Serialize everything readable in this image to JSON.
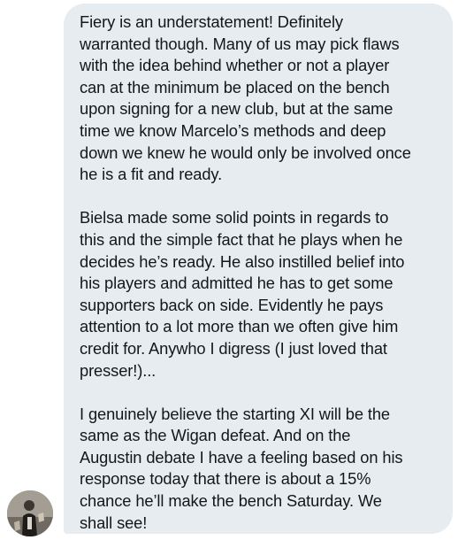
{
  "conversation": {
    "message": {
      "paragraphs": [
        "Fiery is an understatement! Definitely\nwarranted though. Many of us may pick flaws\nwith the idea behind whether or not a player\ncan at the minimum be placed on the bench\nupon signing for a new club, but at the same\ntime we know Marcelo’s methods and deep\ndown we knew he would only be involved once\nhe is a fit and ready.",
        "Bielsa made some solid points in regards to\nthis and the simple fact that he plays when he\ndecides he’s ready. He also instilled belief into\nhis players and admitted he has to get some\nsupporters back on side. Evidently he pays\nattention to a lot more than we often give him\ncredit for. Anywho I digress (I just loved that\npresser!)...",
        "I genuinely believe the starting XI will be the\nsame as the Wigan defeat. And on the\nAugustin debate I have a feeling based on his\nresponse today that there is about a 15%\nchance he’ll make the bench Saturday. We\nshall see!"
      ]
    },
    "sender_avatar": {
      "icon": "user-avatar-photo"
    }
  },
  "colors": {
    "bubble_background": "#e6ecf0",
    "text": "#14171a"
  }
}
